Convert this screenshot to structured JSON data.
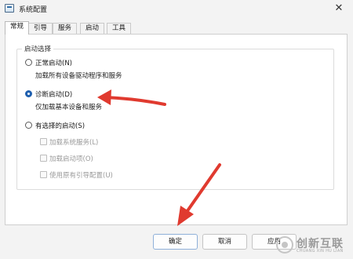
{
  "window": {
    "title": "系统配置",
    "app_icon": "msconfig-icon",
    "close_glyph": "✕"
  },
  "tabs": [
    {
      "label": "常规",
      "active": true
    },
    {
      "label": "引导",
      "active": false
    },
    {
      "label": "服务",
      "active": false
    },
    {
      "label": "启动",
      "active": false
    },
    {
      "label": "工具",
      "active": false
    }
  ],
  "startup": {
    "group_title": "启动选择",
    "normal": {
      "label": "正常启动(N)",
      "description": "加载所有设备驱动程序和服务",
      "selected": false
    },
    "diagnostic": {
      "label": "诊断启动(D)",
      "description": "仅加载基本设备和服务",
      "selected": true
    },
    "selective": {
      "label": "有选择的启动(S)",
      "selected": false,
      "options": [
        {
          "label": "加载系统服务(L)",
          "checked": false,
          "enabled": false
        },
        {
          "label": "加载启动项(O)",
          "checked": false,
          "enabled": false
        },
        {
          "label": "使用原有引导配置(U)",
          "checked": false,
          "enabled": false
        }
      ]
    }
  },
  "buttons": {
    "ok": "确定",
    "cancel": "取消",
    "apply": "应用"
  },
  "annotations": {
    "arrow_color": "#e03a2f"
  },
  "watermark": {
    "text": "创新互联",
    "sub": "CHUANG XIN HU LIAN"
  },
  "colors": {
    "accent": "#1f5fae",
    "panel_bg": "#ffffff",
    "window_bg": "#f3f3f3"
  }
}
